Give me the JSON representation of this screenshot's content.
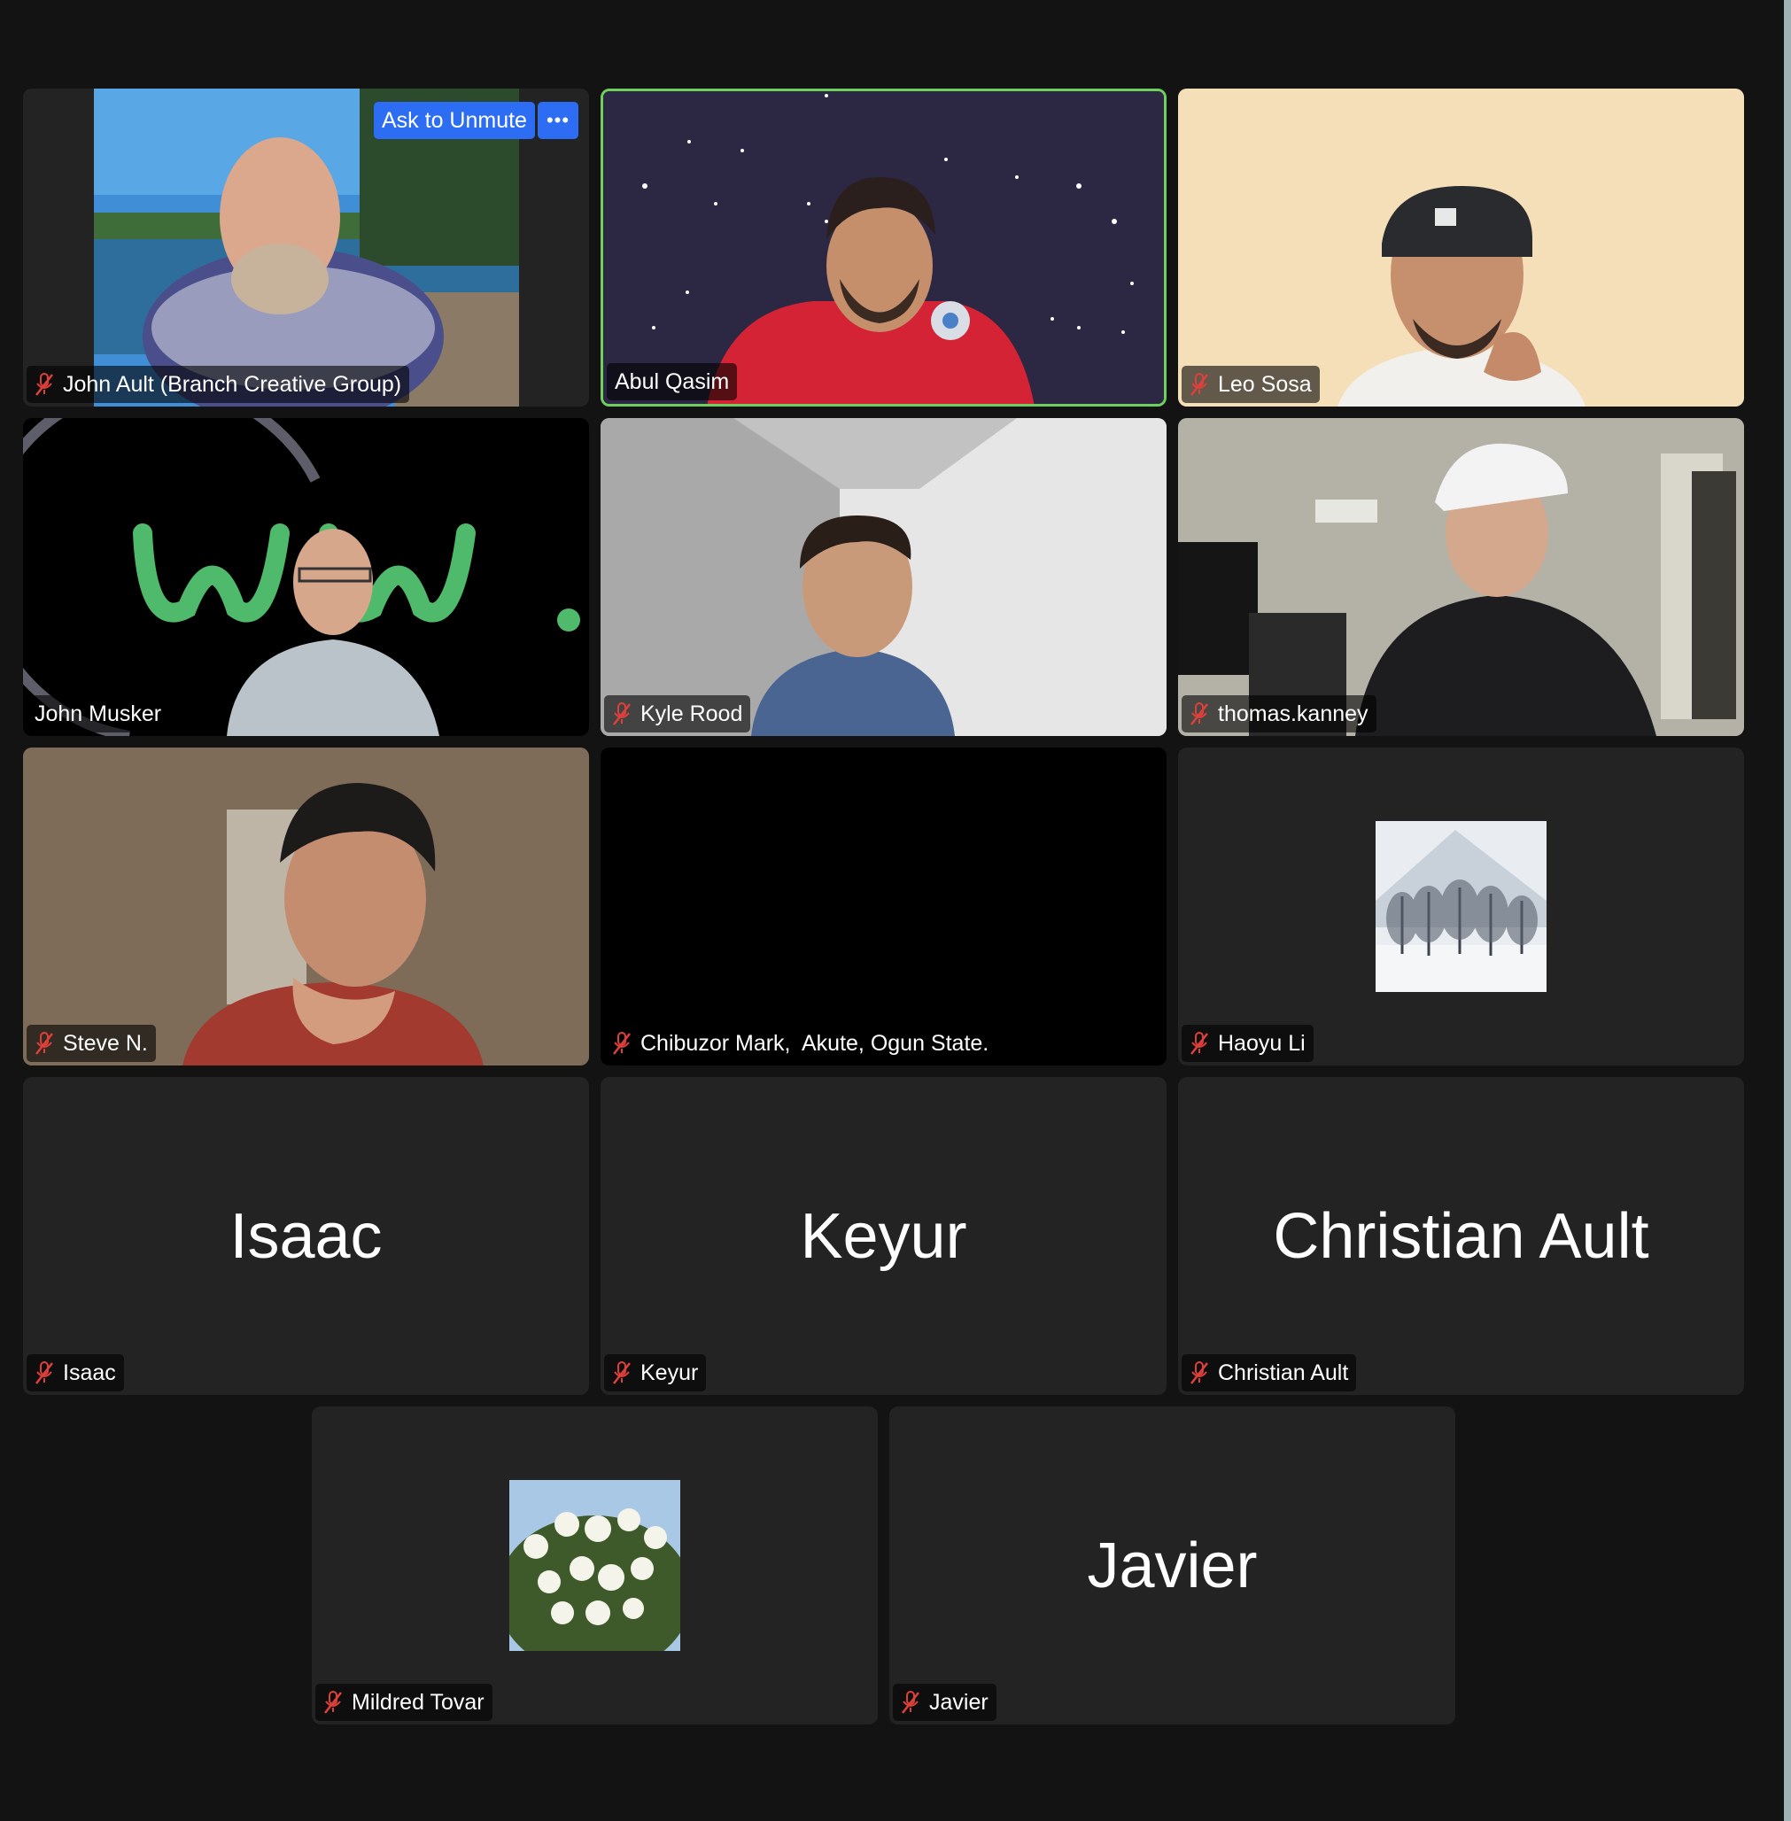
{
  "participants": [
    {
      "name": "John Ault (Branch Creative Group)",
      "muted": true,
      "video": "on",
      "active": false
    },
    {
      "name": "Abul Qasim",
      "muted": false,
      "video": "on",
      "active": true
    },
    {
      "name": "Leo Sosa",
      "muted": true,
      "video": "on",
      "active": false
    },
    {
      "name": "John Musker",
      "muted": false,
      "video": "on",
      "active": false
    },
    {
      "name": "Kyle Rood",
      "muted": true,
      "video": "on",
      "active": false
    },
    {
      "name": "thomas.kanney",
      "muted": true,
      "video": "on",
      "active": false
    },
    {
      "name": "Steve N.",
      "muted": true,
      "video": "on",
      "active": false
    },
    {
      "name": "Chibuzor Mark,  Akute, Ogun State.",
      "muted": true,
      "video": "black",
      "active": false
    },
    {
      "name": "Haoyu Li",
      "muted": true,
      "video": "avatar",
      "active": false
    },
    {
      "name": "Isaac",
      "display_name": "Isaac",
      "muted": true,
      "video": "off"
    },
    {
      "name": "Keyur",
      "display_name": "Keyur",
      "muted": true,
      "video": "off"
    },
    {
      "name": "Christian Ault",
      "display_name": "Christian Ault",
      "muted": true,
      "video": "off"
    },
    {
      "name": "Mildred Tovar",
      "muted": true,
      "video": "avatar"
    },
    {
      "name": "Javier",
      "display_name": "Javier",
      "muted": true,
      "video": "off"
    }
  ],
  "tile_controls": {
    "ask_to_unmute_label": "Ask to Unmute",
    "more_label": "•••"
  },
  "colors": {
    "active_speaker_border": "#6fcf5f",
    "button_blue": "#2d6df3",
    "muted_icon": "#e0403a",
    "tile_bg": "#232323",
    "window_bg": "#131313"
  },
  "icons": [
    "mic-muted-icon",
    "more-icon"
  ]
}
